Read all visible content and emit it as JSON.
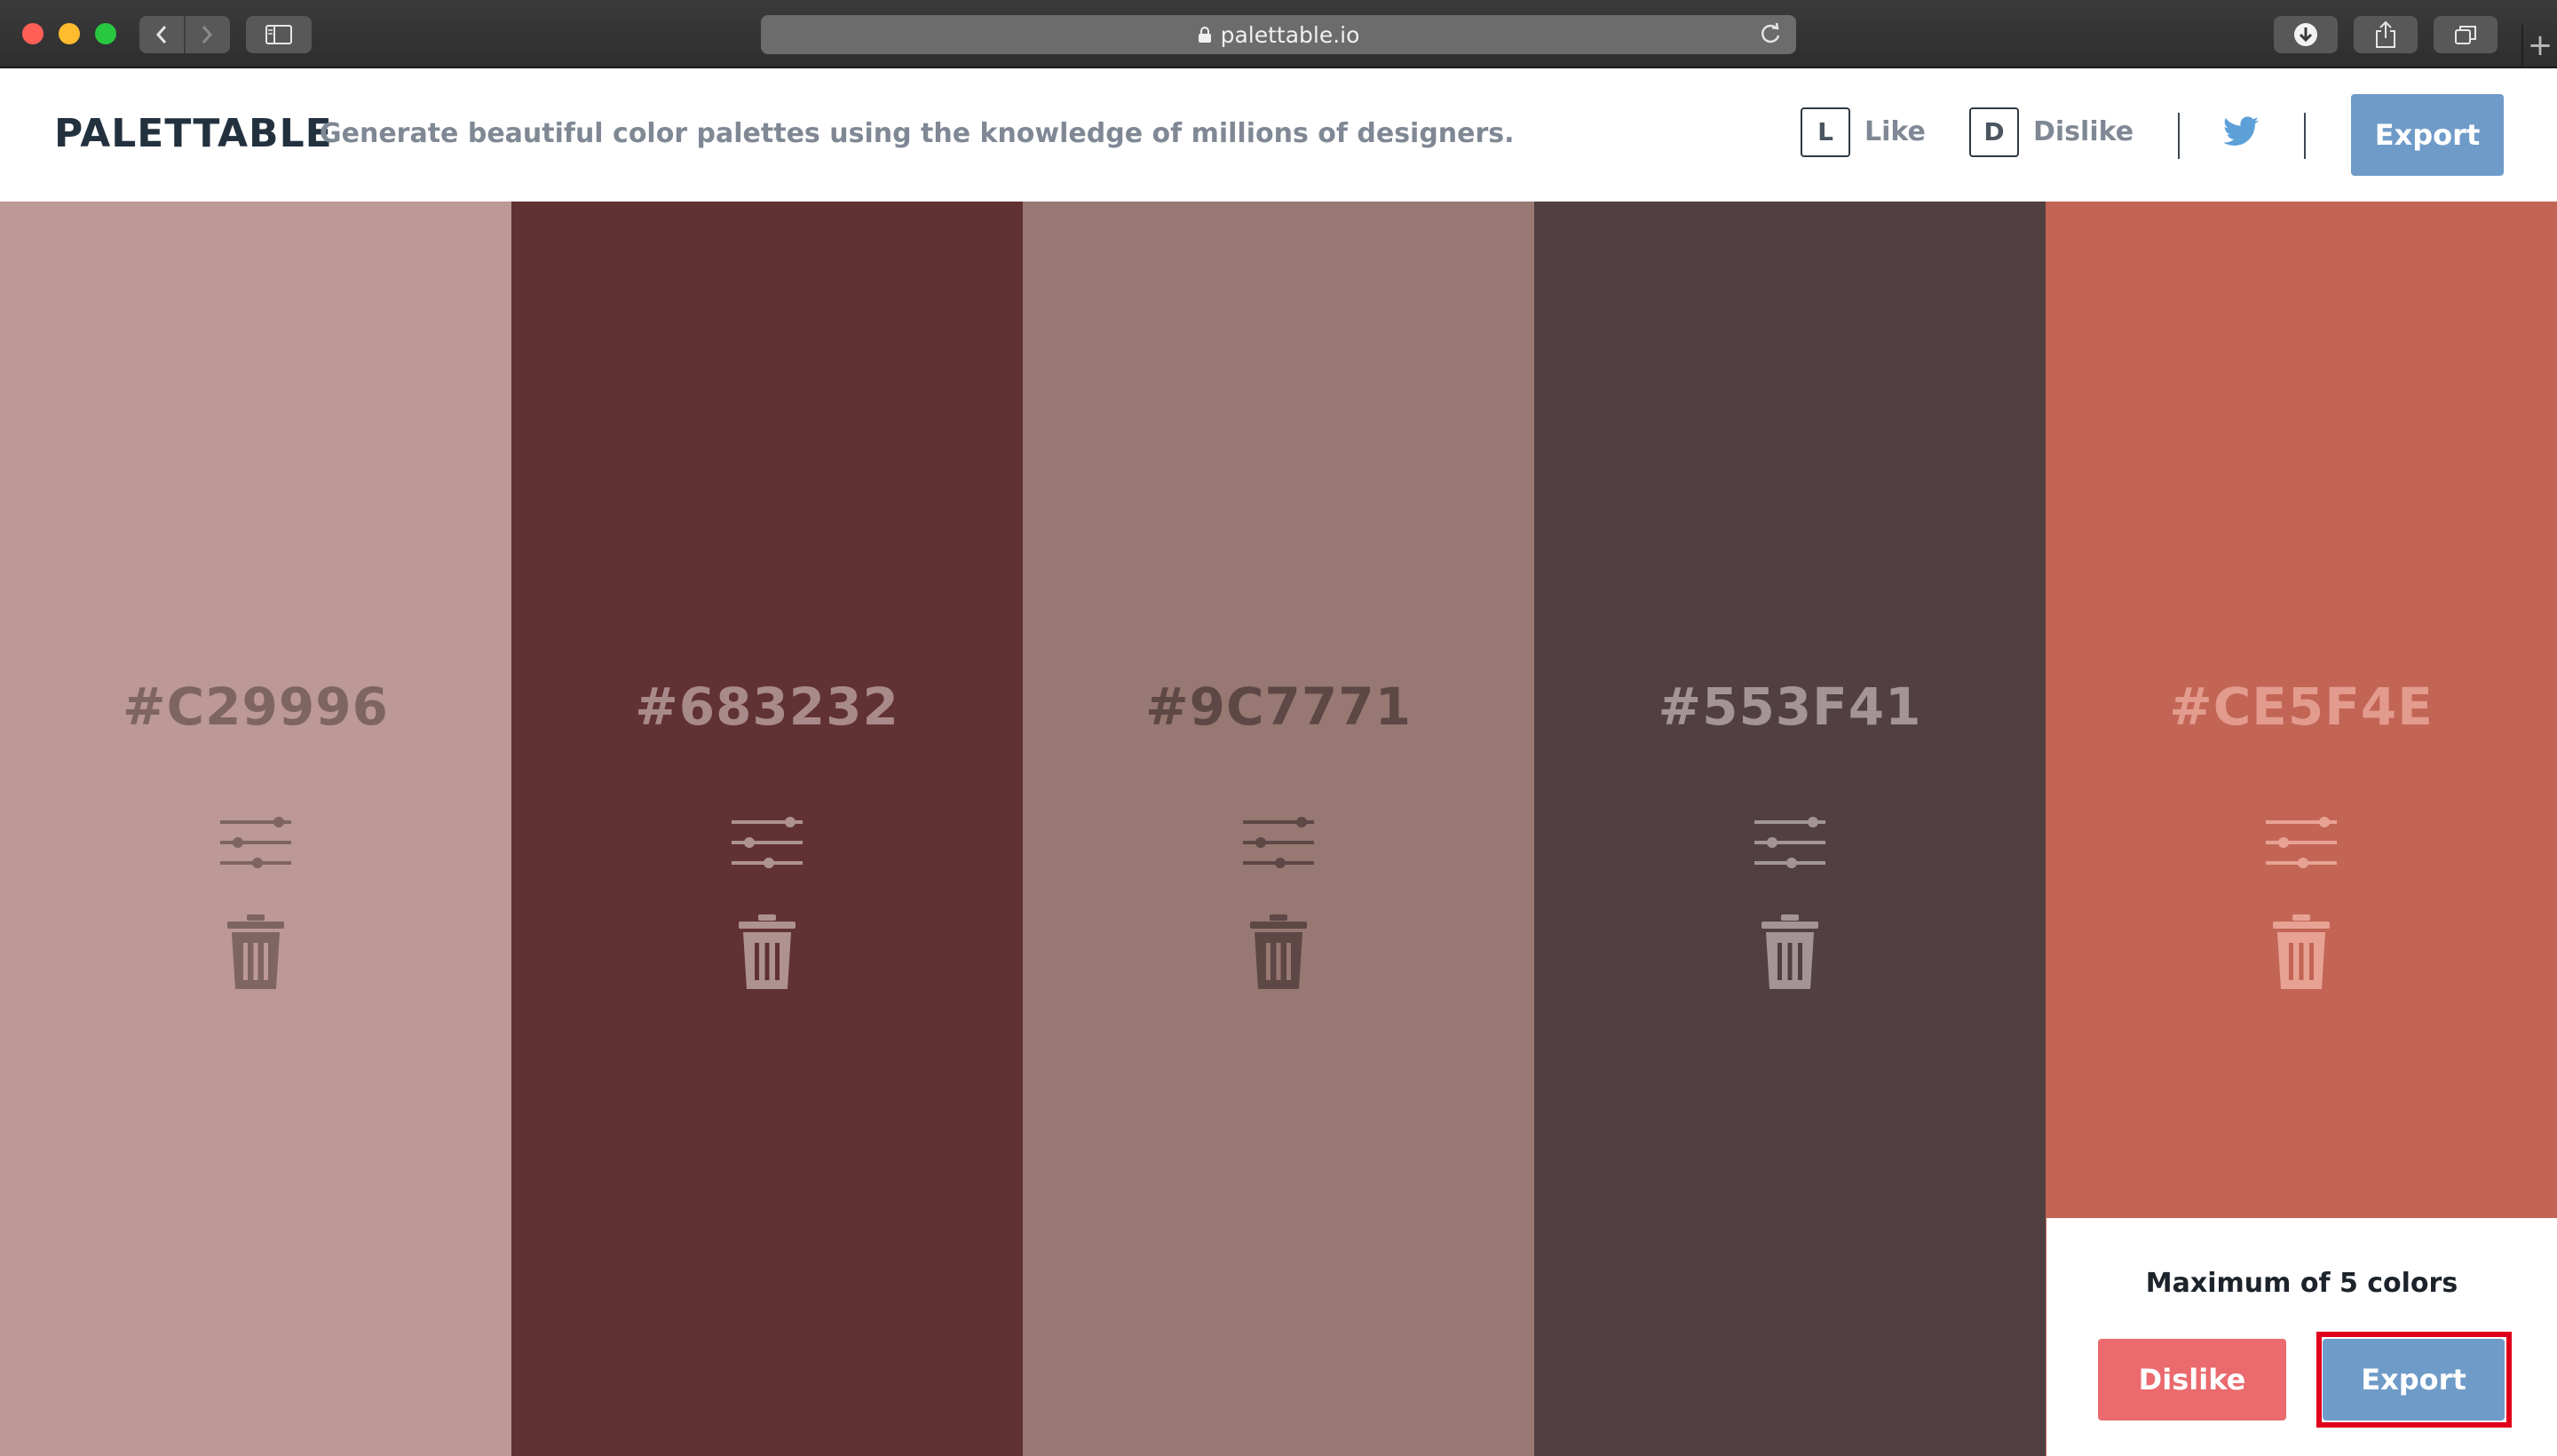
{
  "browser": {
    "url": "palettable.io",
    "back_icon": "chevron-left-icon",
    "forward_icon": "chevron-right-icon",
    "new_tab_label": "+"
  },
  "header": {
    "logo": "PALETTABLE",
    "tagline": "Generate beautiful color palettes using the knowledge of millions of designers.",
    "like_key": "L",
    "like_label": "Like",
    "dislike_key": "D",
    "dislike_label": "Dislike",
    "export_label": "Export"
  },
  "palette": {
    "colors": [
      {
        "hex": "#C29996",
        "bg": "#bc9896",
        "label_color": "#7e6562",
        "icon_color": "#7e6562"
      },
      {
        "hex": "#683232",
        "bg": "#613233",
        "label_color": "#a98a8a",
        "icon_color": "#ad9290"
      },
      {
        "hex": "#9C7771",
        "bg": "#987873",
        "label_color": "#5d4845",
        "icon_color": "#5d4845"
      },
      {
        "hex": "#553F41",
        "bg": "#513f41",
        "label_color": "#a39597",
        "icon_color": "#a39597"
      },
      {
        "hex": "#CE5F4E",
        "bg": "#c26555",
        "label_color": "#e39b8e",
        "icon_color": "#e7a294"
      }
    ]
  },
  "limit_panel": {
    "message": "Maximum of 5 colors",
    "dislike_label": "Dislike",
    "export_label": "Export"
  },
  "colors": {
    "brand_dark": "#23313f",
    "accent_blue": "#6f9bc8",
    "dislike_red": "#ea6a6e",
    "highlight_red": "#e0001b",
    "twitter_blue": "#5da0d8"
  }
}
